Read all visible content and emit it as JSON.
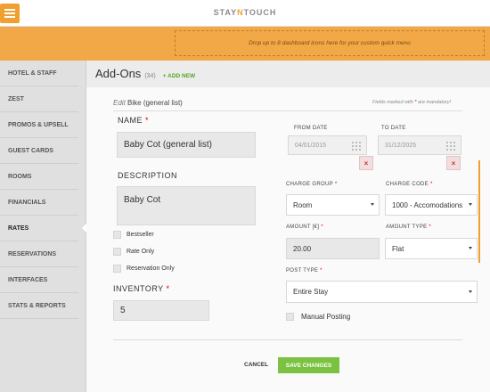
{
  "brand": {
    "logo_left": "STAY",
    "logo_n": "N",
    "logo_right": "TOUCH",
    "accent": "#f3a847"
  },
  "dropzone_text": "Drop up to 8 dashboard icons here for your custom quick menu",
  "sidebar": {
    "items": [
      {
        "label": "HOTEL & STAFF"
      },
      {
        "label": "ZEST"
      },
      {
        "label": "PROMOS & UPSELL"
      },
      {
        "label": "GUEST CARDS"
      },
      {
        "label": "ROOMS"
      },
      {
        "label": "FINANCIALS"
      },
      {
        "label": "RATES"
      },
      {
        "label": "RESERVATIONS"
      },
      {
        "label": "INTERFACES"
      },
      {
        "label": "STATS & REPORTS"
      }
    ]
  },
  "header": {
    "title": "Add-Ons",
    "count": "(34)",
    "add_label": "+ ADD NEW"
  },
  "edit": {
    "prefix": "Edit",
    "name": "Bike (general list)"
  },
  "mandatory": {
    "pre": "Fields marked with",
    "star": "*",
    "post": "are mandatory!"
  },
  "form": {
    "name_label": "NAME",
    "name_value": "Baby Cot (general list)",
    "description_label": "DESCRIPTION",
    "description_value": "Baby Cot",
    "checkboxes": [
      {
        "label": "Bestseller"
      },
      {
        "label": "Rate Only"
      },
      {
        "label": "Reservation Only"
      }
    ],
    "inventory_label": "INVENTORY",
    "inventory_value": "5",
    "from_date_label": "FROM DATE",
    "from_date_value": "04/01/2015",
    "to_date_label": "TO DATE",
    "to_date_value": "31/12/2025",
    "charge_group_label": "CHARGE GROUP",
    "charge_group_value": "Room",
    "charge_code_label": "CHARGE CODE",
    "charge_code_value": "1000 - Accomodations",
    "amount_label": "AMOUNT [€]",
    "amount_value": "20.00",
    "amount_type_label": "AMOUNT TYPE",
    "amount_type_value": "Flat",
    "post_type_label": "POST TYPE",
    "post_type_value": "Entire Stay",
    "manual_posting_label": "Manual Posting",
    "clear_symbol": "×",
    "required_symbol": "*"
  },
  "actions": {
    "cancel": "CANCEL",
    "save": "SAVE CHANGES"
  }
}
